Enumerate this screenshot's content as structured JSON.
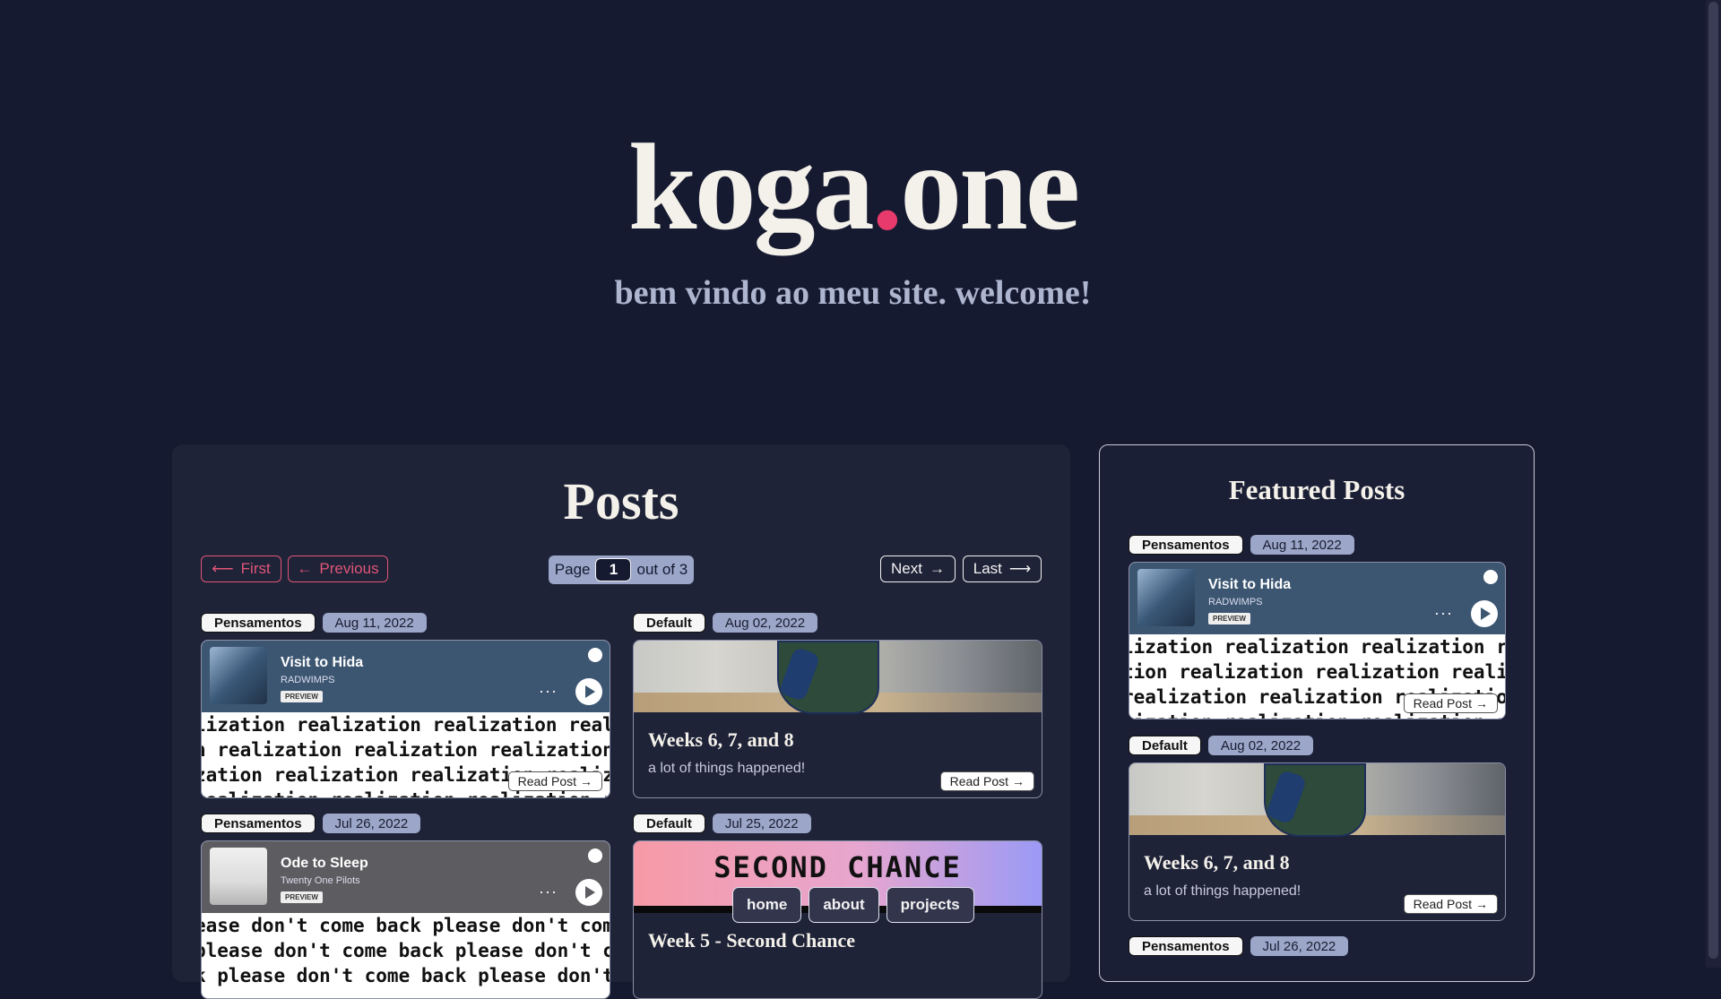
{
  "hero": {
    "logo_left": "koga",
    "logo_dot": ".",
    "logo_right": "one",
    "tagline": "bem vindo ao meu site. welcome!"
  },
  "posts": {
    "title": "Posts",
    "pagination": {
      "first": "First",
      "previous": "Previous",
      "page_label": "Page",
      "page_value": "1",
      "page_total": "out of 3",
      "next": "Next",
      "last": "Last"
    },
    "cards": [
      {
        "category": "Pensamentos",
        "date": "Aug 11, 2022",
        "spotify": {
          "title": "Visit to Hida",
          "artist": "RADWIMPS",
          "preview": "PREVIEW"
        },
        "repeat_lines": [
          "lization realization realization reali",
          "n realization realization realization",
          "zation realization realization realiza",
          "realization realization realization re"
        ],
        "read_label": "Read Post"
      },
      {
        "category": "Default",
        "date": "Aug 02, 2022",
        "title": "Weeks 6, 7, and 8",
        "description": "a lot of things happened!",
        "read_label": "Read Post"
      },
      {
        "category": "Pensamentos",
        "date": "Jul 26, 2022",
        "spotify": {
          "title": "Ode to Sleep",
          "artist": "Twenty One Pilots",
          "preview": "PREVIEW"
        },
        "repeat_lines": [
          "ease don't come back please don't come",
          "please don't come back please don't co",
          "k please don't come back please don't"
        ]
      },
      {
        "category": "Default",
        "date": "Jul 25, 2022",
        "cover_text": "SECOND CHANCE",
        "title": "Week 5 - Second Chance"
      }
    ]
  },
  "nav": {
    "home": "home",
    "about": "about",
    "projects": "projects"
  },
  "featured": {
    "title": "Featured Posts",
    "cards": [
      {
        "category": "Pensamentos",
        "date": "Aug 11, 2022",
        "spotify": {
          "title": "Visit to Hida",
          "artist": "RADWIMPS",
          "preview": "PREVIEW"
        },
        "repeat_lines": [
          "lization realization realization realiz",
          "tion realization realization realiza",
          "realization realization realizatio",
          "lization realization realization r"
        ],
        "read_label": "Read Post"
      },
      {
        "category": "Default",
        "date": "Aug 02, 2022",
        "title": "Weeks 6, 7, and 8",
        "description": "a lot of things happened!",
        "read_label": "Read Post"
      },
      {
        "category": "Pensamentos",
        "date": "Jul 26, 2022"
      }
    ]
  },
  "colors": {
    "background": "#161a30",
    "accent_pink": "#e83a6c",
    "tag_date": "#9ba6c9"
  },
  "icons": [
    "arrow-left-double-icon",
    "arrow-left-icon",
    "arrow-right-icon",
    "arrow-right-double-icon",
    "spotify-icon",
    "play-icon",
    "more-icon"
  ]
}
